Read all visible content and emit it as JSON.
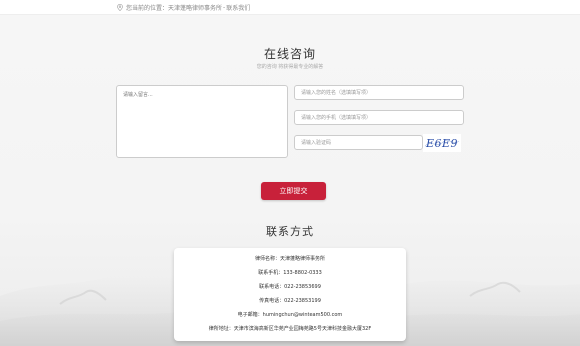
{
  "breadcrumb": {
    "prefix": "您当前的位置：",
    "site": "天津蓬略律师事务所",
    "separator": " - ",
    "current": "联系我们"
  },
  "form": {
    "title": "在线咨询",
    "subtitle": "您的咨询 将获得最专业的解答",
    "message_placeholder": "请输入留言...",
    "name_placeholder": "请输入您的姓名（选填填写项）",
    "phone_placeholder": "请输入您的手机（选填填写项）",
    "captcha_placeholder": "请输入验证码",
    "captcha_text": "E6E9",
    "submit_label": "立即提交"
  },
  "contact": {
    "title": "联系方式",
    "rows": [
      "律师名称：天津蓬略律师事务所",
      "联系手机：133-8802-0333",
      "联系电话：022-23853699",
      "传真电话：022-23853199",
      "电子邮箱：humingchun@winteam500.com",
      "律所地址：天津市滨海高新区华苑产业园梅苑路5号天津科技金融大厦32F"
    ]
  },
  "colors": {
    "accent": "#c8213a",
    "background": "#f6f6f6"
  }
}
